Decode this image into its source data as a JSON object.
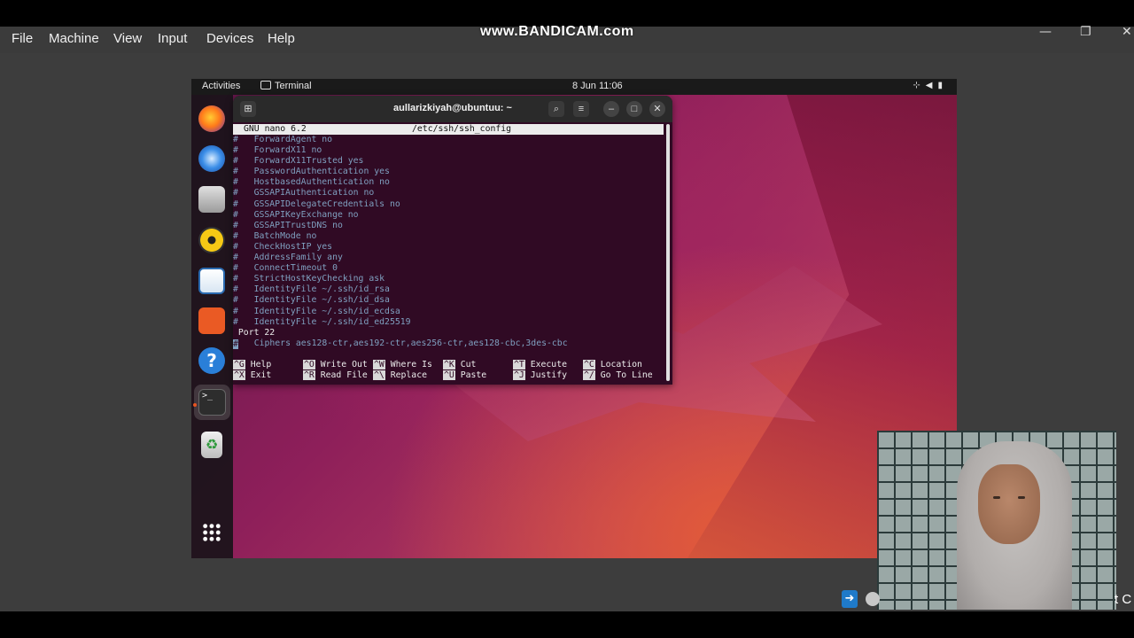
{
  "host": {
    "menu": [
      "File",
      "Machine",
      "View",
      "Input",
      "Devices",
      "Help"
    ],
    "watermark": "www.BANDICAM.com",
    "controls": {
      "minimize": "—",
      "restore": "❐",
      "close": "✕"
    }
  },
  "guest": {
    "topbar": {
      "activities": "Activities",
      "app": "Terminal",
      "clock": "8 Jun  11:06",
      "tray_icons": [
        "network-icon",
        "volume-icon",
        "battery-icon"
      ]
    },
    "dock": {
      "apps": [
        "firefox",
        "thunderbird",
        "files",
        "rhythmbox",
        "libreoffice-writer",
        "app-center",
        "help",
        "terminal",
        "trash",
        "show-applications"
      ],
      "help_glyph": "?",
      "terminal_glyph": ">_",
      "trash_glyph": "♻"
    },
    "terminal": {
      "title": "aullarizkiyah@ubuntuu: ~",
      "nano": {
        "version": "GNU nano 6.2",
        "file": "/etc/ssh/ssh_config",
        "lines": [
          "#   ForwardAgent no",
          "#   ForwardX11 no",
          "#   ForwardX11Trusted yes",
          "#   PasswordAuthentication yes",
          "#   HostbasedAuthentication no",
          "#   GSSAPIAuthentication no",
          "#   GSSAPIDelegateCredentials no",
          "#   GSSAPIKeyExchange no",
          "#   GSSAPITrustDNS no",
          "#   BatchMode no",
          "#   CheckHostIP yes",
          "#   AddressFamily any",
          "#   ConnectTimeout 0",
          "#   StrictHostKeyChecking ask",
          "#   IdentityFile ~/.ssh/id_rsa",
          "#   IdentityFile ~/.ssh/id_dsa",
          "#   IdentityFile ~/.ssh/id_ecdsa",
          "#   IdentityFile ~/.ssh/id_ed25519",
          " Port 22"
        ],
        "cursor_line": "   Ciphers aes128-ctr,aes192-ctr,aes256-ctr,aes128-cbc,3des-cbc",
        "cursor_char": "#",
        "shortcuts": [
          {
            "key": "^G",
            "label": "Help"
          },
          {
            "key": "^X",
            "label": "Exit"
          },
          {
            "key": "^O",
            "label": "Write Out"
          },
          {
            "key": "^R",
            "label": "Read File"
          },
          {
            "key": "^W",
            "label": "Where Is"
          },
          {
            "key": "^\\",
            "label": "Replace"
          },
          {
            "key": "^K",
            "label": "Cut"
          },
          {
            "key": "^U",
            "label": "Paste"
          },
          {
            "key": "^T",
            "label": "Execute"
          },
          {
            "key": "^J",
            "label": "Justify"
          },
          {
            "key": "^C",
            "label": "Location"
          },
          {
            "key": "^/",
            "label": "Go To Line"
          }
        ]
      }
    }
  },
  "overlay": {
    "bottom_right_text": "t C"
  },
  "colors": {
    "terminal_bg": "#300a24",
    "comment": "#7fa0c0",
    "ubuntu_orange": "#e95420"
  }
}
